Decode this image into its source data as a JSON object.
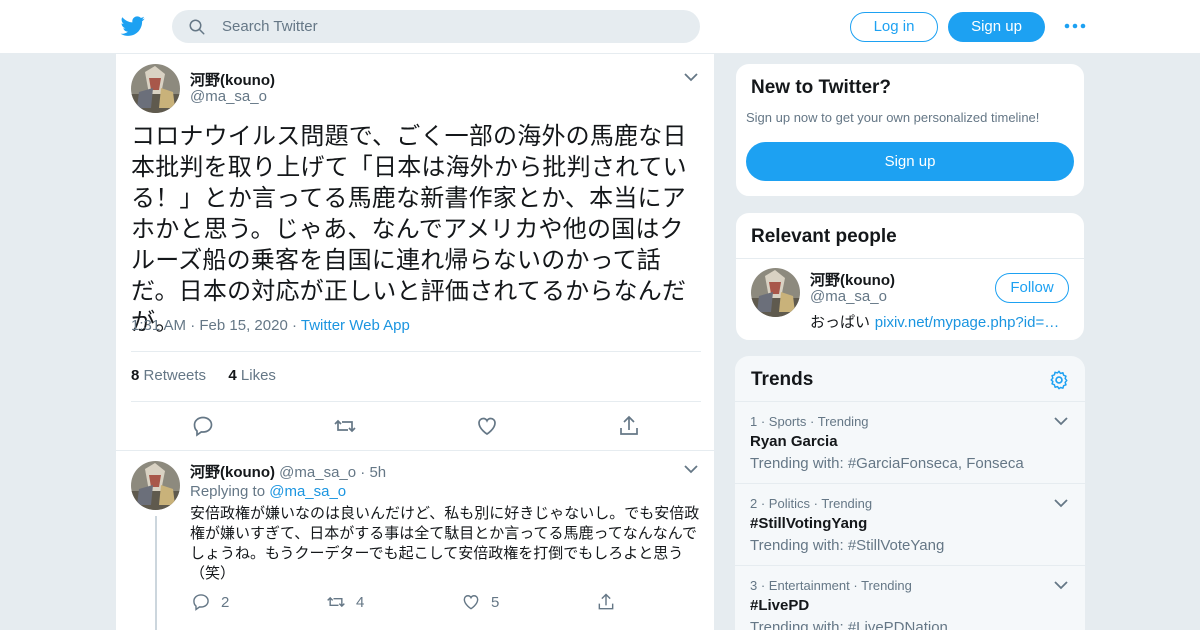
{
  "header": {
    "search_placeholder": "Search Twitter",
    "login_label": "Log in",
    "signup_label": "Sign up",
    "accent": "#1da1f2"
  },
  "tweet": {
    "name": "河野(kouno)",
    "handle": "@ma_sa_o",
    "text": "コロナウイルス問題で、ごく一部の海外の馬鹿な日本批判を取り上げて「日本は海外から批判されている！」とか言ってる馬鹿な新書作家とか、本当にアホかと思う。じゃあ、なんでアメリカや他の国はクルーズ船の乗客を自国に連れ帰らないのかって話だ。日本の対応が正しいと評価されてるからなんだが。",
    "time": "1:31 AM",
    "date": "Feb 15, 2020",
    "source": "Twitter Web App",
    "retweets_count": "8",
    "retweets_label": "Retweets",
    "likes_count": "4",
    "likes_label": "Likes"
  },
  "reply": {
    "name": "河野(kouno)",
    "handle": "@ma_sa_o",
    "age": "5h",
    "replying_prefix": "Replying to",
    "replying_to": "@ma_sa_o",
    "text": "安倍政権が嫌いなのは良いんだけど、私も別に好きじゃないし。でも安倍政権が嫌いすぎて、日本がする事は全て駄目とか言ってる馬鹿ってなんなんでしょうね。もうクーデターでも起こして安倍政権を打倒でもしろよと思う（笑）",
    "replies_count": "2",
    "retweets_count": "4",
    "likes_count": "5"
  },
  "new_to_twitter": {
    "title": "New to Twitter?",
    "subtitle": "Sign up now to get your own personalized timeline!",
    "signup_label": "Sign up"
  },
  "relevant_people": {
    "title": "Relevant people",
    "name": "河野(kouno)",
    "handle": "@ma_sa_o",
    "follow_label": "Follow",
    "bio_text": "おっぱい",
    "bio_link": "pixiv.net/mypage.php?id=…"
  },
  "trends": {
    "title": "Trends",
    "items": [
      {
        "rank": "1",
        "category": "Sports",
        "status": "Trending",
        "name": "Ryan Garcia",
        "with": "Trending with: #GarciaFonseca, Fonseca"
      },
      {
        "rank": "2",
        "category": "Politics",
        "status": "Trending",
        "name": "#StillVotingYang",
        "with": "Trending with: #StillVoteYang"
      },
      {
        "rank": "3",
        "category": "Entertainment",
        "status": "Trending",
        "name": "#LivePD",
        "with": "Trending with: #LivePDNation"
      }
    ]
  }
}
